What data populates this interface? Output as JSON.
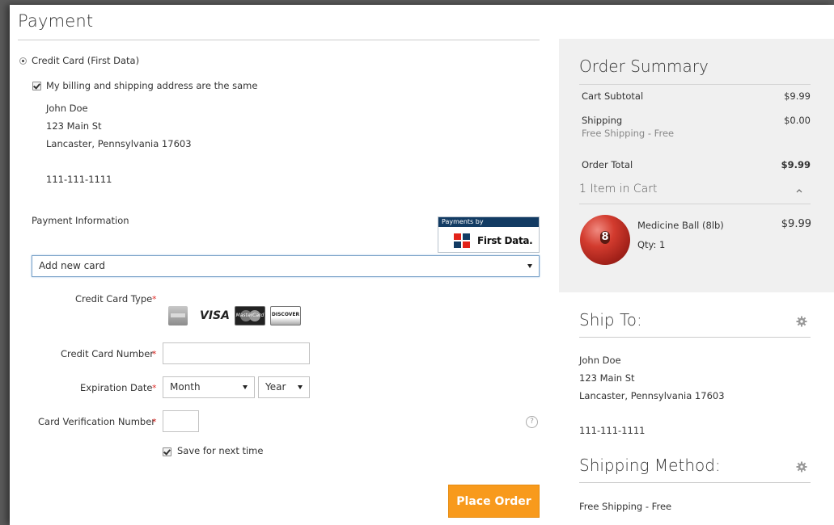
{
  "payment": {
    "title": "Payment",
    "method_label": "Credit Card (First Data)",
    "same_address_label": "My billing and shipping address are the same",
    "billing_address": {
      "name": "John Doe",
      "street": "123 Main St",
      "city_line": "Lancaster, Pennsylvania 17603",
      "phone": "111-111-1111"
    },
    "info_label": "Payment Information",
    "badge_caption": "Payments by",
    "badge_brand": "First Data.",
    "card_select": "Add new card",
    "form": {
      "type_label": "Credit Card Type",
      "number_label": "Credit Card Number",
      "exp_label": "Expiration Date",
      "cvv_label": "Card Verification Number",
      "required_mark": "*",
      "month_select": "Month",
      "year_select": "Year",
      "save_label": "Save for next time",
      "help_mark": "?"
    },
    "card_types": {
      "visa": "VISA",
      "mastercard": "MasterCard",
      "discover": "DISCOVER"
    },
    "place_order": "Place Order"
  },
  "summary": {
    "title": "Order Summary",
    "subtotal_label": "Cart Subtotal",
    "subtotal_value": "$9.99",
    "shipping_label": "Shipping",
    "shipping_value": "$0.00",
    "shipping_method": "Free Shipping - Free",
    "total_label": "Order Total",
    "total_value": "$9.99",
    "items_label": "1 Item in Cart",
    "item": {
      "name": "Medicine Ball (8lb)",
      "qty": "Qty: 1",
      "price": "$9.99",
      "ball_number": "8"
    }
  },
  "ship_to": {
    "title": "Ship To:",
    "name": "John Doe",
    "street": "123 Main St",
    "city_line": "Lancaster, Pennsylvania 17603",
    "phone": "111-111-1111"
  },
  "shipping_method": {
    "title": "Shipping Method:",
    "value": "Free Shipping - Free"
  },
  "colors": {
    "accent_orange": "#f89a1c",
    "required_red": "#e02b27",
    "first_data_blue": "#123b63",
    "summary_bg": "#f0f0f0"
  }
}
